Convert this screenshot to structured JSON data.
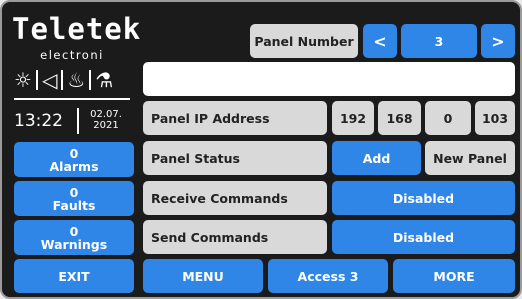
{
  "brand": {
    "logo": "Teletek",
    "subtitle": "electroni"
  },
  "status": {
    "time": "13:22",
    "date_line1": "02.07.",
    "date_line2": "2021",
    "icons": [
      "sun-icon",
      "speaker-icon",
      "fire-icon",
      "fire-extinguisher-icon"
    ]
  },
  "header": {
    "panel_number_label": "Panel Number",
    "prev_label": "<",
    "panel_number_value": "3",
    "next_label": ">",
    "message_value": ""
  },
  "sidebar": {
    "alarms_count": "0",
    "alarms_label": "Alarms",
    "faults_count": "0",
    "faults_label": "Faults",
    "warnings_count": "0",
    "warnings_label": "Warnings"
  },
  "rows": {
    "ip_label": "Panel IP Address",
    "ip_octets": [
      "192",
      "168",
      "0",
      "103"
    ],
    "status_label": "Panel Status",
    "add_label": "Add",
    "new_panel_label": "New Panel",
    "receive_label": "Receive Commands",
    "receive_value": "Disabled",
    "send_label": "Send Commands",
    "send_value": "Disabled"
  },
  "footer": {
    "exit_label": "EXIT",
    "menu_label": "MENU",
    "access_label": "Access 3",
    "more_label": "MORE"
  },
  "colors": {
    "background": "#1b1b1b",
    "accent": "#2f86e6",
    "button_gray": "#d9d9d9"
  }
}
